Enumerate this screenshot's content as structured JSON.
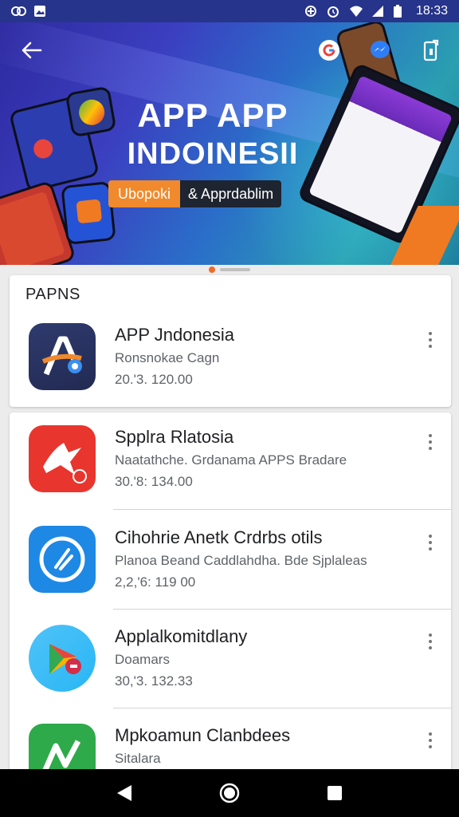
{
  "status_bar": {
    "time": "18:33",
    "left_icons": [
      "vpn-icon",
      "image-notification-icon"
    ],
    "right_icons": [
      "data-saver-icon",
      "alarm-icon",
      "wifi-icon",
      "signal-icon",
      "battery-icon"
    ]
  },
  "toolbar": {
    "back_icon": "arrow-left-icon",
    "actions": [
      "google-icon",
      "messenger-icon",
      "share-icon"
    ]
  },
  "hero": {
    "title_line1": "APP APP",
    "title_line2": "INDOINESII",
    "tag_orange": "Ubopoki",
    "tag_dark": "& Apprdablim"
  },
  "pager": {
    "pages": 2,
    "active": 0
  },
  "section": {
    "title": "PAPNS",
    "featured": {
      "name": "APP Jndonesia",
      "desc": "Ronsnokae Cagn",
      "meta": "20.'3. 120.00"
    }
  },
  "list": [
    {
      "name": "Spplra Rlatosia",
      "desc": "Naatathche. Grdanama APPS Bradare",
      "meta": "30.'8: 134.00"
    },
    {
      "name": "Cihohrie Anetk Crdrbs otils",
      "desc": "Planoa Beand Caddlahdha. Bde Sjplaleas",
      "meta": "2,2,'6: 119 00"
    },
    {
      "name": "Applalkomitdlany",
      "desc": "Doamars",
      "meta": "30,'3. 132.33"
    },
    {
      "name": "Mpkoamun Clanbdees",
      "desc": "Sitalara",
      "meta": ""
    }
  ],
  "colors": {
    "status_bar": "#27348b",
    "accent_orange": "#f08a2c",
    "nav_bar": "#000000"
  },
  "nav_icons": [
    "back-triangle-icon",
    "home-circle-icon",
    "recents-square-icon"
  ]
}
